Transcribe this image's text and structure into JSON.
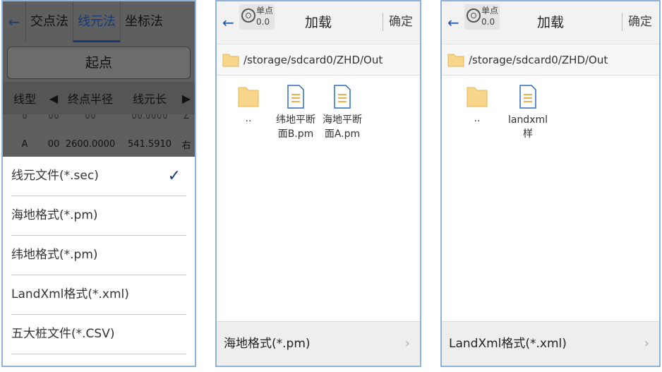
{
  "panel1": {
    "tabs": [
      "交点法",
      "线元法",
      "坐标法"
    ],
    "active_tab": 1,
    "start_button": "起点",
    "table": {
      "headers": [
        "线型",
        "终点半径",
        "线元长"
      ],
      "ghost_row": [
        "∪",
        "∪∪",
        "∪∪",
        "∪∪.∪∪∪∪",
        "∠"
      ],
      "row": [
        "A",
        "00",
        "2600.0000",
        "541.5910",
        "右"
      ]
    },
    "menu": {
      "items": [
        "线元文件(*.sec)",
        "海地格式(*.pm)",
        "纬地格式(*.pm)",
        "LandXml格式(*.xml)",
        "五大桩文件(*.CSV)"
      ],
      "checked_index": 0
    }
  },
  "panel2": {
    "single_point": {
      "label": "单点",
      "value": "0.0"
    },
    "title": "加载",
    "confirm": "确定",
    "path": "/storage/sdcard0/ZHD/Out",
    "files": [
      {
        "name": "..",
        "type": "folder"
      },
      {
        "name": "纬地平断面B.pm",
        "type": "file"
      },
      {
        "name": "海地平断面A.pm",
        "type": "file"
      }
    ],
    "format": "海地格式(*.pm)"
  },
  "panel3": {
    "single_point": {
      "label": "单点",
      "value": "0.0"
    },
    "title": "加载",
    "confirm": "确定",
    "path": "/storage/sdcard0/ZHD/Out",
    "files": [
      {
        "name": "..",
        "type": "folder"
      },
      {
        "name": "landxml样",
        "type": "file"
      }
    ],
    "format": "LandXml格式(*.xml)"
  },
  "colors": {
    "accent": "#1b3a75",
    "panel_border": "#8fb2d6",
    "icon_orange": "#f2b04c",
    "icon_blue": "#2d6cc4"
  }
}
